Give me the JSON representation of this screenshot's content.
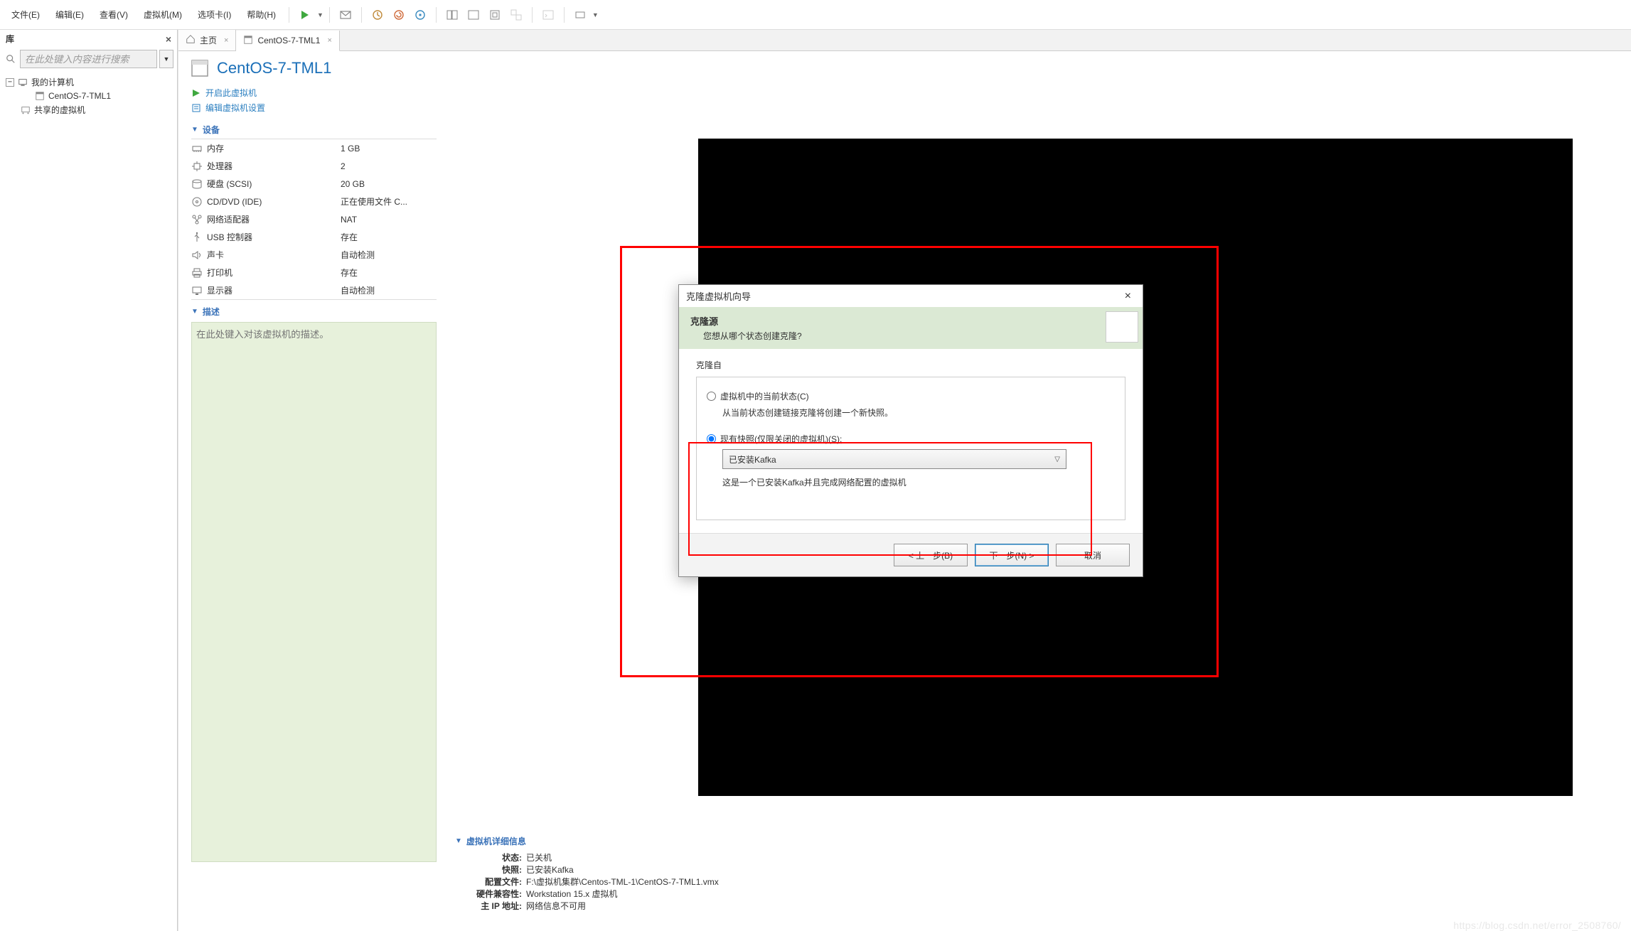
{
  "menu": {
    "file": "文件(E)",
    "edit": "编辑(E)",
    "view": "查看(V)",
    "vm": "虚拟机(M)",
    "tabs": "选项卡(I)",
    "help": "帮助(H)"
  },
  "sidebar": {
    "title": "库",
    "search_placeholder": "在此处键入内容进行搜索",
    "nodes": {
      "root": "我的计算机",
      "vm": "CentOS-7-TML1",
      "shared": "共享的虚拟机"
    }
  },
  "tabs": {
    "home": "主页",
    "vm": "CentOS-7-TML1"
  },
  "vm": {
    "title": "CentOS-7-TML1",
    "actions": {
      "power_on": "开启此虚拟机",
      "edit_settings": "编辑虚拟机设置"
    },
    "devices_head": "设备",
    "devices": {
      "memory": {
        "label": "内存",
        "value": "1 GB"
      },
      "cpu": {
        "label": "处理器",
        "value": "2"
      },
      "disk": {
        "label": "硬盘 (SCSI)",
        "value": "20 GB"
      },
      "cddvd": {
        "label": "CD/DVD (IDE)",
        "value": "正在使用文件 C..."
      },
      "net": {
        "label": "网络适配器",
        "value": "NAT"
      },
      "usb": {
        "label": "USB 控制器",
        "value": "存在"
      },
      "sound": {
        "label": "声卡",
        "value": "自动检测"
      },
      "printer": {
        "label": "打印机",
        "value": "存在"
      },
      "display": {
        "label": "显示器",
        "value": "自动检测"
      }
    },
    "desc_head": "描述",
    "desc_placeholder": "在此处键入对该虚拟机的描述。"
  },
  "wizard": {
    "title": "克隆虚拟机向导",
    "banner_title": "克隆源",
    "banner_sub": "您想从哪个状态创建克隆?",
    "group": "克隆自",
    "opt_current": "虚拟机中的当前状态(C)",
    "opt_current_sub": "从当前状态创建链接克隆将创建一个新快照。",
    "opt_snapshot": "现有快照(仅限关闭的虚拟机)(S):",
    "combo_value": "已安装Kafka",
    "combo_sub": "这是一个已安装Kafka并且完成网络配置的虚拟机",
    "btn_back": "< 上一步(B)",
    "btn_next": "下一步(N) >",
    "btn_cancel": "取消"
  },
  "details": {
    "head": "虚拟机详细信息",
    "rows": {
      "state": {
        "label": "状态:",
        "value": "已关机"
      },
      "snapshot": {
        "label": "快照:",
        "value": "已安装Kafka"
      },
      "config": {
        "label": "配置文件:",
        "value": "F:\\虚拟机集群\\Centos-TML-1\\CentOS-7-TML1.vmx"
      },
      "compat": {
        "label": "硬件兼容性:",
        "value": "Workstation 15.x 虚拟机"
      },
      "ip": {
        "label": "主 IP 地址:",
        "value": "网络信息不可用"
      }
    }
  },
  "watermark": "https://blog.csdn.net/error_2508760/"
}
